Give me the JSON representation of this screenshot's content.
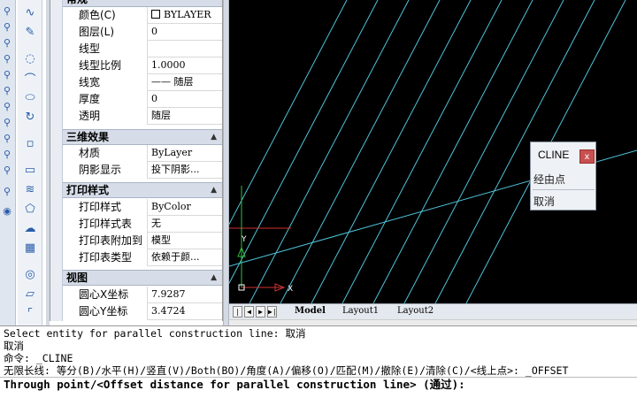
{
  "toolbar_left": {
    "icons": [
      "curve-icon",
      "pencil-icon",
      "loop-icon",
      "spline-icon",
      "polygon-icon",
      "rotate-icon",
      "point-icon",
      "rectangle-icon",
      "spring-icon",
      "pentagon-icon",
      "cloud-icon",
      "target-icon",
      "chat-icon",
      "arc-icon"
    ]
  },
  "properties": {
    "general_rows": [
      {
        "key": "颜色(C)",
        "value": "BYLAYER",
        "swatch": "#ffffff"
      },
      {
        "key": "图层(L)",
        "value": "0"
      },
      {
        "key": "线型",
        "value": ""
      },
      {
        "key": "线型比例",
        "value": "1.0000"
      },
      {
        "key": "线宽",
        "value": "—— 随层"
      },
      {
        "key": "厚度",
        "value": "0"
      },
      {
        "key": "透明",
        "value": "随层"
      }
    ],
    "section_3d": {
      "label": "三维效果",
      "rows": [
        {
          "key": "材质",
          "value": "ByLayer"
        },
        {
          "key": "阴影显示",
          "value": "投下阴影..."
        }
      ]
    },
    "section_print": {
      "label": "打印样式",
      "rows": [
        {
          "key": "打印样式",
          "value": "ByColor"
        },
        {
          "key": "打印样式表",
          "value": "无"
        },
        {
          "key": "打印表附加到",
          "value": "模型"
        },
        {
          "key": "打印表类型",
          "value": "依赖于颜..."
        }
      ]
    },
    "section_view": {
      "label": "视图",
      "rows": [
        {
          "key": "圆心X坐标",
          "value": "7.9287"
        },
        {
          "key": "圆心Y坐标",
          "value": "3.4724"
        }
      ]
    },
    "top_header": "常规"
  },
  "drawing": {
    "background": "#000000",
    "line_color": "#4fc3d9",
    "axis_x_label": "X",
    "axis_y_label": "Y"
  },
  "tabs": {
    "nav": [
      "|◀",
      "◀",
      "▶",
      "▶|"
    ],
    "items": [
      {
        "label": "Model",
        "active": true
      },
      {
        "label": "Layout1",
        "active": false
      },
      {
        "label": "Layout2",
        "active": false
      }
    ]
  },
  "popup": {
    "title": "CLINE",
    "close": "x",
    "items": [
      "经由点",
      "取消"
    ]
  },
  "command": {
    "history": [
      "Select entity for parallel construction line: 取消",
      "取消",
      "命令: _CLINE",
      "无限长线: 等分(B)/水平(H)/竖直(V)/Both(BO)/角度(A)/偏移(O)/匹配(M)/撤除(E)/清除(C)/<线上点>: _OFFSET"
    ],
    "prompt": "Through point/<Offset distance for parallel construction line> (通过):"
  }
}
